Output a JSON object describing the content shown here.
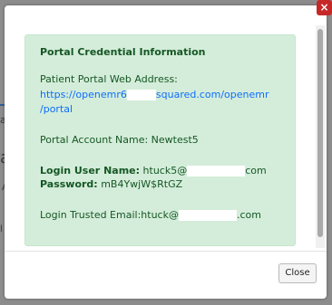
{
  "background_fragments": [
    "a",
    "a",
    "A",
    "l"
  ],
  "close_x": "×",
  "panel": {
    "title": "Portal Credential Information",
    "web_address_label": "Patient Portal Web Address:",
    "web_address_part1": "https://openemr6",
    "web_address_part2": "squared.com/openemr",
    "web_address_line2": "/portal",
    "account_label": "Portal Account Name: Newtest5",
    "login_user_label": "Login User Name:",
    "login_user_value_start": "htuck5@",
    "login_user_value_end": "com",
    "password_label": "Password:",
    "password_value": "mB4YwjW$RtGZ",
    "trusted_email_label": "Login Trusted Email:",
    "trusted_email_start": "htuck@",
    "trusted_email_end": ".com"
  },
  "footer": {
    "close_label": "Close"
  },
  "colors": {
    "panel_bg": "#d4edda",
    "panel_text": "#155724",
    "link": "#0d6efd",
    "close_x_bg": "#c62828"
  }
}
